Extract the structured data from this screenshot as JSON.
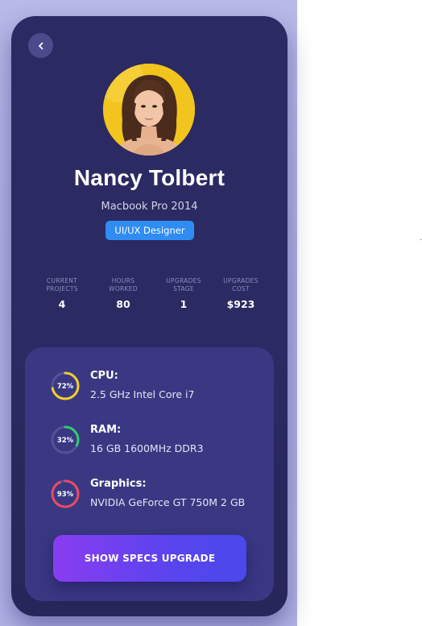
{
  "colors": {
    "phone_bg": "#2b2a63",
    "card_bg": "#3a3883",
    "badge_blue": "#2f8cf3",
    "cpu_ring": "#f4cf2a",
    "ram_ring": "#2ecc71",
    "graphics_ring": "#ec4a63",
    "button_gradient_start": "#8a3cf0",
    "button_gradient_end": "#4a48ec"
  },
  "header": {
    "back_icon": "chevron-left-icon"
  },
  "profile": {
    "name": "Nancy Tolbert",
    "device": "Macbook Pro 2014",
    "role": "UI/UX Designer"
  },
  "stats": [
    {
      "label": "CURRENT\nPROJECTS",
      "value": "4"
    },
    {
      "label": "HOURS\nWORKED",
      "value": "80"
    },
    {
      "label": "UPGRADES\nSTAGE",
      "value": "1"
    },
    {
      "label": "UPGRADES\nCOST",
      "value": "$923"
    }
  ],
  "specs": [
    {
      "title": "CPU:",
      "value": "2.5 GHz Intel Core i7",
      "percent_label": "72%",
      "percent": 72,
      "ring_color": "#f4cf2a"
    },
    {
      "title": "RAM:",
      "value": "16 GB 1600MHz DDR3",
      "percent_label": "32%",
      "percent": 32,
      "ring_color": "#2ecc71"
    },
    {
      "title": "Graphics:",
      "value": "NVIDIA GeForce GT 750M 2 GB",
      "percent_label": "93%",
      "percent": 93,
      "ring_color": "#ec4a63"
    }
  ],
  "actions": {
    "upgrade_label": "SHOW SPECS UPGRADE"
  }
}
